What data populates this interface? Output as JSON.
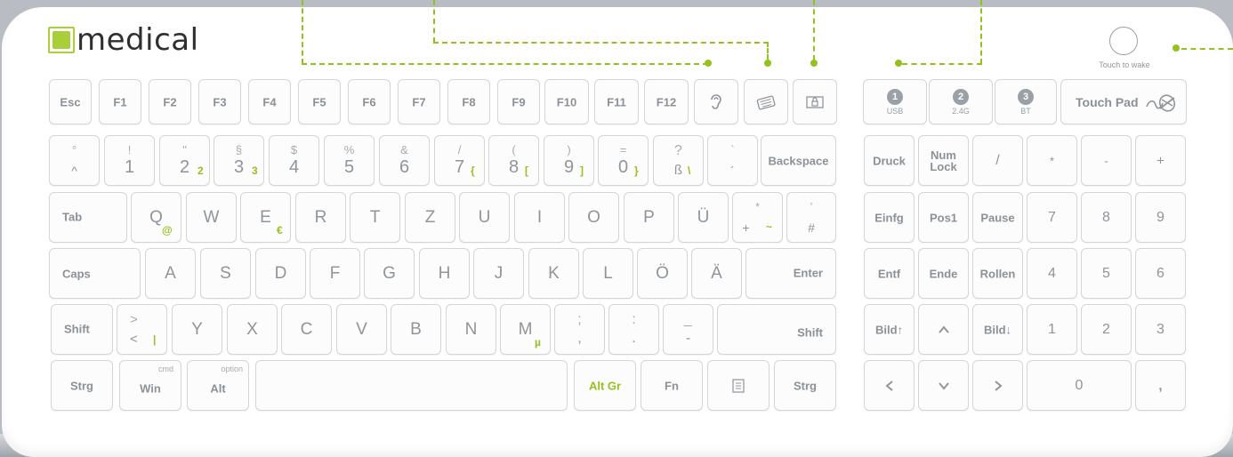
{
  "brand": {
    "logo_text": "medical"
  },
  "wake": {
    "label": "Touch to wake"
  },
  "keys": {
    "esc": "Esc",
    "f1": "F1",
    "f2": "F2",
    "f3": "F3",
    "f4": "F4",
    "f5": "F5",
    "f6": "F6",
    "f7": "F7",
    "f8": "F8",
    "f9": "F9",
    "f10": "F10",
    "f11": "F11",
    "f12": "F12",
    "n1": {
      "top": "!",
      "bot": "1"
    },
    "n2": {
      "top": "\"",
      "bot": "2",
      "alt": "2"
    },
    "n3": {
      "top": "§",
      "bot": "3",
      "alt": "3"
    },
    "n4": {
      "top": "$",
      "bot": "4"
    },
    "n5": {
      "top": "%",
      "bot": "5"
    },
    "n6": {
      "top": "&",
      "bot": "6"
    },
    "n7": {
      "top": "/",
      "bot": "7",
      "alt": "{"
    },
    "n8": {
      "top": "(",
      "bot": "8",
      "alt": "["
    },
    "n9": {
      "top": ")",
      "bot": "9",
      "alt": "]"
    },
    "n0": {
      "top": "=",
      "bot": "0",
      "alt": "}"
    },
    "circ": {
      "top": "°",
      "bot": "^"
    },
    "ss": {
      "top": "?",
      "bot": "ß",
      "alt": "\\"
    },
    "acc": {
      "top": "`",
      "bot": "´"
    },
    "backspace": "Backspace",
    "tab": "Tab",
    "q": "Q",
    "q_alt": "@",
    "w": "W",
    "e": "E",
    "e_alt": "€",
    "r": "R",
    "t": "T",
    "z": "Z",
    "u": "U",
    "i": "I",
    "o": "O",
    "p": "P",
    "ue": "Ü",
    "plus": {
      "top": "*",
      "bot": "+",
      "alt": "~"
    },
    "hash": {
      "top": "'",
      "bot": "#"
    },
    "caps": "Caps",
    "a": "A",
    "s": "S",
    "d": "D",
    "f": "F",
    "g": "G",
    "h": "H",
    "j": "J",
    "k": "K",
    "l": "L",
    "oe": "Ö",
    "ae": "Ä",
    "enter": "Enter",
    "shift_l": "Shift",
    "lt": {
      "top": ">",
      "bot": "<",
      "alt": "|"
    },
    "y": "Y",
    "x": "X",
    "c": "C",
    "v": "V",
    "b": "B",
    "n": "N",
    "m": "M",
    "m_alt": "µ",
    "comma": {
      "top": ";",
      "bot": ","
    },
    "period": {
      "top": ":",
      "bot": "."
    },
    "minus": {
      "top": "_",
      "bot": "-"
    },
    "shift_r": "Shift",
    "strg_l": "Strg",
    "win": "Win",
    "win_sub": "cmd",
    "alt": "Alt",
    "alt_sub": "option",
    "altgr": "Alt Gr",
    "fn": "Fn",
    "strg_r": "Strg",
    "ch1": {
      "num": "1",
      "label": "USB"
    },
    "ch2": {
      "num": "2",
      "label": "2.4G"
    },
    "ch3": {
      "num": "3",
      "label": "BT"
    },
    "touchpad": "Touch Pad",
    "druck": "Druck",
    "numlock": "Num\nLock",
    "kp_div": "/",
    "kp_mul": "*",
    "kp_sub": "-",
    "kp_add": "+",
    "einfg": "Einfg",
    "pos1": "Pos1",
    "pause": "Pause",
    "kp7": "7",
    "kp8": "8",
    "kp9": "9",
    "entf": "Entf",
    "ende": "Ende",
    "rollen": "Rollen",
    "kp4": "4",
    "kp5": "5",
    "kp6": "6",
    "bild_up": "Bild↑",
    "up": "^",
    "bild_down": "Bild↓",
    "kp1": "1",
    "kp2": "2",
    "kp3": "3",
    "left": "<",
    "down": "v",
    "right": ">",
    "kp0": "0",
    "kp_dec": ","
  },
  "colors": {
    "accent": "#95c11f",
    "key_text": "#8f959b",
    "key_border": "#d3d5d8"
  }
}
